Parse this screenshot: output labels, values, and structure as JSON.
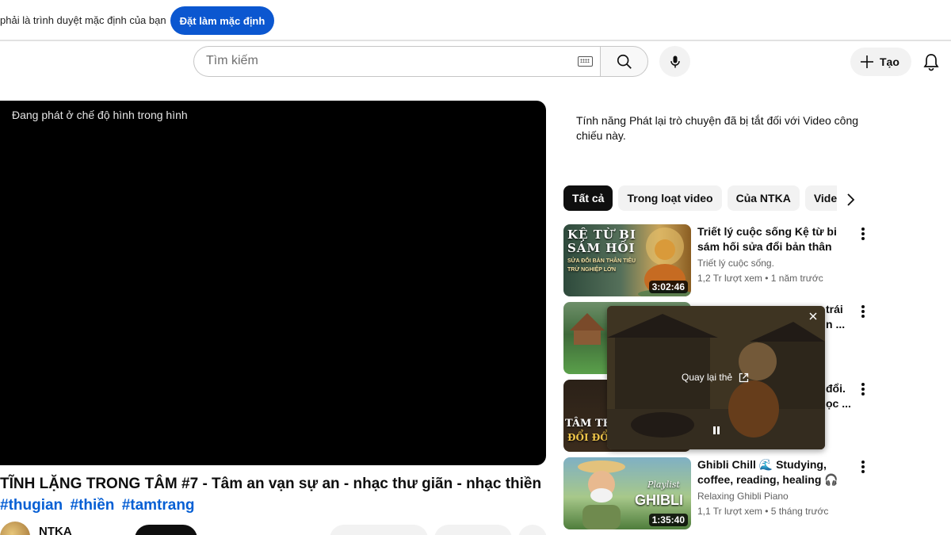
{
  "banner": {
    "message": "phải là trình duyệt mặc định của bạn",
    "button_label": "Đặt làm mặc định"
  },
  "masthead": {
    "search_placeholder": "Tìm kiếm",
    "create_label": "Tạo"
  },
  "player": {
    "pip_message": "Đang phát ở chế độ hình trong hình"
  },
  "video": {
    "title": "TĨNH LẶNG TRONG TÂM #7 - Tâm an vạn sự an - nhạc thư giãn - nhạc thiền",
    "hashtags": [
      "#thugian",
      "#thiền",
      "#tamtrang"
    ],
    "channel": "NTKA"
  },
  "sidebar": {
    "chat_disabled_note": "Tính năng Phát lại trò chuyện đã bị tắt đối với Video công chiếu này.",
    "chips": [
      "Tất cả",
      "Trong loạt video",
      "Của NTKA",
      "Video"
    ],
    "items": [
      {
        "title": "Triết lý cuộc sống   Kệ từ bi sám hối sửa đổi bản thân  tiêu trừ ...",
        "channel": "Triết lý cuộc sống.",
        "meta": "1,2 Tr lượt xem • 1 năm trước",
        "duration": "3:02:46",
        "thumb_text_1": "KỆ TỪ BI",
        "thumb_text_2": "SÁM HỐI",
        "thumb_text_3": "SỬA ĐỔI BẢN THÂN TIÊU",
        "thumb_text_4": "TRỪ NGHIỆP LỚN"
      },
      {
        "title_tail_1": "trái",
        "title_tail_2": "n ..."
      },
      {
        "title_tail_1": "đổi.",
        "title_tail_2": "ọc ...",
        "thumb_text_1": "TÂM THA",
        "thumb_text_2": "ĐỔI ĐỔI"
      },
      {
        "title": "Ghibli Chill 🌊 Studying, coffee, reading, healing 🎧 Ghibli ...",
        "channel": "Relaxing Ghibli Piano",
        "meta": "1,1 Tr lượt xem • 5 tháng trước",
        "duration": "1:35:40",
        "thumb_text_1": "Playlist",
        "thumb_text_2": "GHIBLI"
      }
    ]
  },
  "mini_player": {
    "return_label": "Quay lại thẻ"
  },
  "colors": {
    "accent_blue": "#0b57d0",
    "link_blue": "#065fd4"
  }
}
